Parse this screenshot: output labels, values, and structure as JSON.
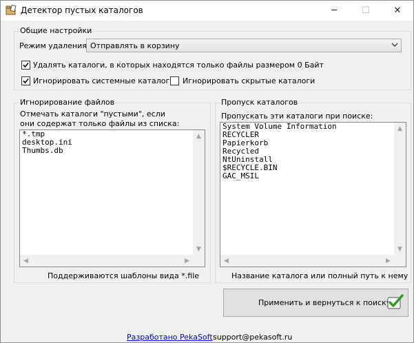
{
  "window": {
    "title": "Детектор пустых каталогов",
    "minimize_glyph": "─",
    "maximize_glyph": "☐",
    "close_glyph": "✕"
  },
  "general": {
    "legend": "Общие настройки",
    "delete_mode_label": "Режим удаления:",
    "delete_mode_value": "Отправлять в корзину",
    "delete_zero_label": "Удалять каталоги, в которых находятся только файлы размером 0 Байт",
    "delete_zero_checked": true,
    "ignore_system_label": "Игнорировать системные каталоги",
    "ignore_system_checked": true,
    "ignore_hidden_label": "Игнорировать скрытые каталоги",
    "ignore_hidden_checked": false
  },
  "ignore_files": {
    "legend": "Игнорирование файлов",
    "desc_line1": "Отмечать каталоги \"пустыми\", если",
    "desc_line2": "они содержат только файлы из списка:",
    "items": [
      "*.tmp",
      "desktop.ini",
      "Thumbs.db"
    ],
    "hint": "Поддерживаются шаблоны вида *.file"
  },
  "skip_dirs": {
    "legend": "Пропуск каталогов",
    "desc": "Пропускать эти каталоги при поиске:",
    "items": [
      "System Volume Information",
      "RECYCLER",
      "Papierkorb",
      "Recycled",
      "NtUninstall",
      "$RECYCLE.BIN",
      "GAC_MSIL"
    ],
    "hint": "Название каталога или полный путь к нему"
  },
  "apply_button": {
    "label": "Применить и вернуться к поиску",
    "icon": "green-checkmark-icon"
  },
  "footer": {
    "developer_link": "Разработано PekaSoft",
    "email": "support@pekasoft.ru"
  },
  "colors": {
    "check_green": "#2e9a1e",
    "link": "#0000ee"
  }
}
